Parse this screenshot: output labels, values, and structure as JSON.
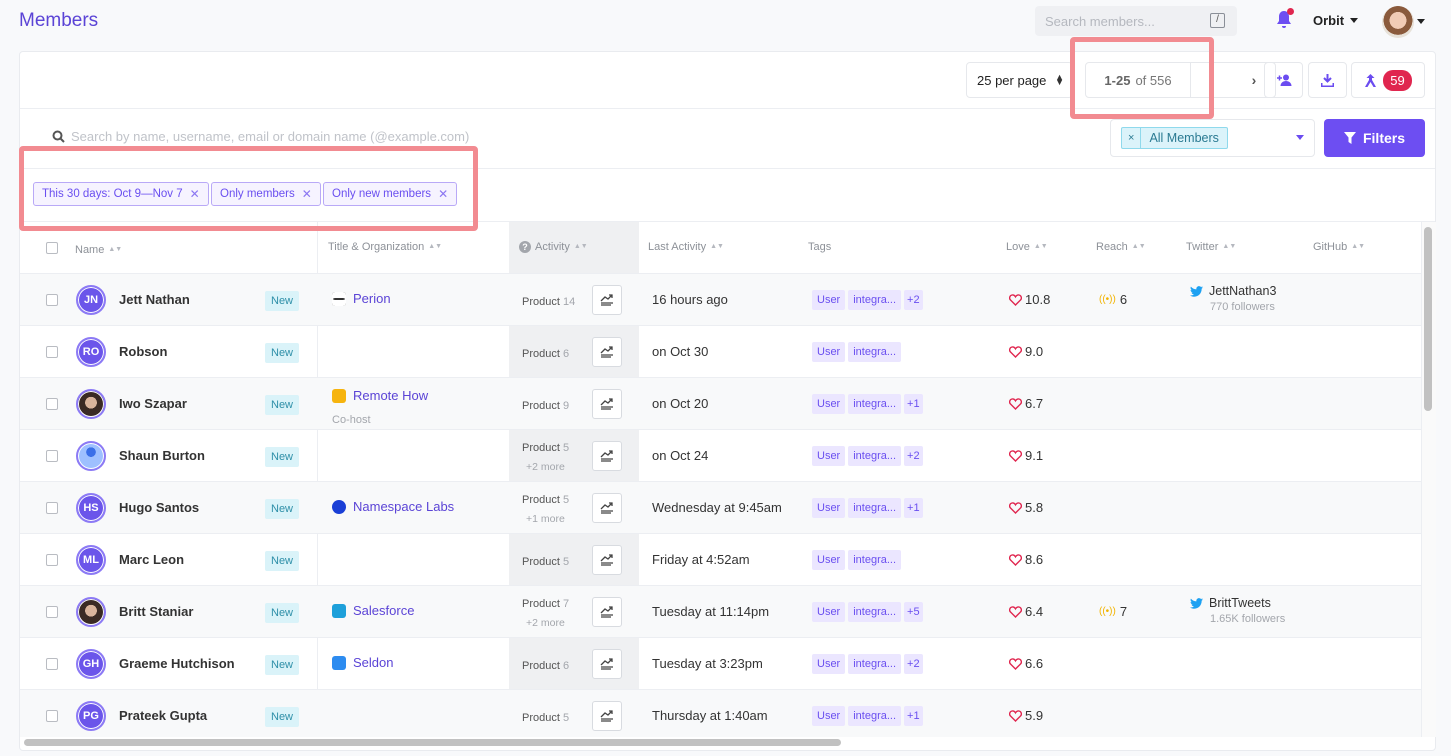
{
  "header": {
    "title": "Members",
    "search_placeholder": "Search members...",
    "search_shortcut": "/",
    "workspace": "Orbit",
    "notifications_unread": true
  },
  "toolbar": {
    "per_page": "25 per page",
    "range": "1-25",
    "total": "of 556",
    "prev_label": "‹",
    "next_label": "›",
    "add_member_icon": "user-plus-icon",
    "export_icon": "download-icon",
    "merge_icon": "merge-icon",
    "merge_count": "59"
  },
  "search": {
    "placeholder": "Search by name, username, email or domain name (@example.com)"
  },
  "segment": {
    "selected": "All Members",
    "remove_label": "×"
  },
  "filters_button": "Filters",
  "active_filters": [
    {
      "label": "This 30 days: Oct 9—Nov 7"
    },
    {
      "label": "Only members"
    },
    {
      "label": "Only new members"
    }
  ],
  "table": {
    "columns": {
      "name": "Name",
      "title_org": "Title & Organization",
      "activity": "Activity",
      "last_activity": "Last Activity",
      "tags": "Tags",
      "love": "Love",
      "reach": "Reach",
      "twitter": "Twitter",
      "github": "GitHub"
    },
    "rows": [
      {
        "initials": "JN",
        "name": "Jett Nathan",
        "badge": "New",
        "org": "Perion",
        "org_color": "#ffffff",
        "role": "",
        "activity_label": "Product",
        "activity_count": "14",
        "activity_more": "",
        "last_activity": "16 hours ago",
        "tags": [
          "User",
          "integra..."
        ],
        "tags_more": "+2",
        "love": "10.8",
        "reach": "6",
        "twitter": "JettNathan3",
        "twitter_followers": "770 followers"
      },
      {
        "initials": "RO",
        "name": "Robson",
        "badge": "New",
        "org": "",
        "org_color": "",
        "role": "",
        "activity_label": "Product",
        "activity_count": "6",
        "activity_more": "",
        "last_activity": "on Oct 30",
        "tags": [
          "User",
          "integra..."
        ],
        "tags_more": "",
        "love": "9.0",
        "reach": "",
        "twitter": "",
        "twitter_followers": ""
      },
      {
        "initials": "",
        "name": "Iwo Szapar",
        "badge": "New",
        "org": "Remote How",
        "org_color": "#f6b40e",
        "role": "Co-host",
        "activity_label": "Product",
        "activity_count": "9",
        "activity_more": "",
        "last_activity": "on Oct 20",
        "tags": [
          "User",
          "integra..."
        ],
        "tags_more": "+1",
        "love": "6.7",
        "reach": "",
        "twitter": "",
        "twitter_followers": ""
      },
      {
        "initials": "",
        "name": "Shaun Burton",
        "badge": "New",
        "org": "",
        "org_color": "",
        "role": "",
        "activity_label": "Product",
        "activity_count": "5",
        "activity_more": "+2 more",
        "last_activity": "on Oct 24",
        "tags": [
          "User",
          "integra..."
        ],
        "tags_more": "+2",
        "love": "9.1",
        "reach": "",
        "twitter": "",
        "twitter_followers": ""
      },
      {
        "initials": "HS",
        "name": "Hugo Santos",
        "badge": "New",
        "org": "Namespace Labs",
        "org_color": "#1a3fd6",
        "role": "",
        "activity_label": "Product",
        "activity_count": "5",
        "activity_more": "+1 more",
        "last_activity": "Wednesday at 9:45am",
        "tags": [
          "User",
          "integra..."
        ],
        "tags_more": "+1",
        "love": "5.8",
        "reach": "",
        "twitter": "",
        "twitter_followers": ""
      },
      {
        "initials": "ML",
        "name": "Marc Leon",
        "badge": "New",
        "org": "",
        "org_color": "",
        "role": "",
        "activity_label": "Product",
        "activity_count": "5",
        "activity_more": "",
        "last_activity": "Friday at 4:52am",
        "tags": [
          "User",
          "integra..."
        ],
        "tags_more": "",
        "love": "8.6",
        "reach": "",
        "twitter": "",
        "twitter_followers": ""
      },
      {
        "initials": "",
        "name": "Britt Staniar",
        "badge": "New",
        "org": "Salesforce",
        "org_color": "#1ea0da",
        "role": "",
        "activity_label": "Product",
        "activity_count": "7",
        "activity_more": "+2 more",
        "last_activity": "Tuesday at 11:14pm",
        "tags": [
          "User",
          "integra..."
        ],
        "tags_more": "+5",
        "love": "6.4",
        "reach": "7",
        "twitter": "BrittTweets",
        "twitter_followers": "1.65K followers"
      },
      {
        "initials": "GH",
        "name": "Graeme Hutchison",
        "badge": "New",
        "org": "Seldon",
        "org_color": "#2d8cf0",
        "role": "",
        "activity_label": "Product",
        "activity_count": "6",
        "activity_more": "",
        "last_activity": "Tuesday at 3:23pm",
        "tags": [
          "User",
          "integra..."
        ],
        "tags_more": "+2",
        "love": "6.6",
        "reach": "",
        "twitter": "",
        "twitter_followers": ""
      },
      {
        "initials": "PG",
        "name": "Prateek Gupta",
        "badge": "New",
        "org": "",
        "org_color": "",
        "role": "",
        "activity_label": "Product",
        "activity_count": "5",
        "activity_more": "",
        "last_activity": "Thursday at 1:40am",
        "tags": [
          "User",
          "integra..."
        ],
        "tags_more": "+1",
        "love": "5.9",
        "reach": "",
        "twitter": "",
        "twitter_followers": ""
      }
    ]
  },
  "colors": {
    "brand": "#6d4ef2",
    "love": "#e0264f",
    "reach": "#f2b400",
    "twitter": "#1da1f2",
    "annotation": "#f28b91"
  }
}
